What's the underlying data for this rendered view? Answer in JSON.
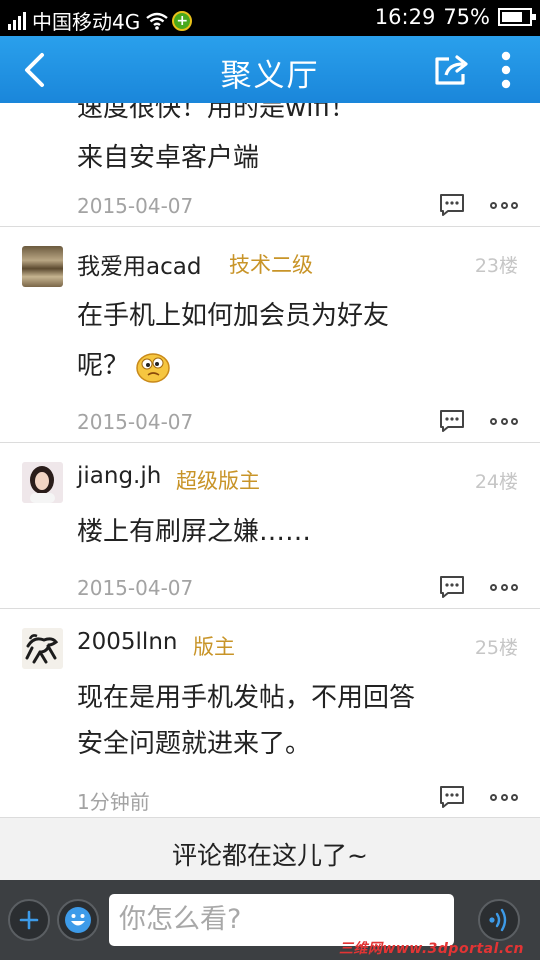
{
  "status_bar": {
    "carrier": "中国移动4G",
    "time": "16:29",
    "battery_percent": "75%",
    "battery_level": 0.75
  },
  "header": {
    "title": "聚义厅",
    "back_icon": "chevron-left-icon",
    "share_icon": "share-icon",
    "more_icon": "more-vertical-icon"
  },
  "posts": [
    {
      "body_lines": [
        "速度很快！用的是wifi！",
        "来自安卓客户端"
      ],
      "date": "2015-04-07"
    },
    {
      "username": "我爱用acad",
      "rank": "技术二级",
      "floor": "23楼",
      "body_lines": [
        "在手机上如何加会员为好友",
        "呢？"
      ],
      "date": "2015-04-07"
    },
    {
      "username": "jiang.jh",
      "rank": "超级版主",
      "floor": "24楼",
      "body_lines": [
        "楼上有刷屏之嫌……"
      ],
      "date": "2015-04-07"
    },
    {
      "username": "2005llnn",
      "rank": "版主",
      "floor": "25楼",
      "body_lines": [
        "现在是用手机发帖，不用回答",
        "安全问题就进来了。"
      ],
      "date": "1分钟前"
    }
  ],
  "footer_hint": "评论都在这儿了~",
  "input_bar": {
    "placeholder": "你怎么看?",
    "add_icon": "plus-icon",
    "emoji_icon": "smiley-icon",
    "voice_icon": "voice-icon"
  },
  "watermark": "三维网www.3dportal.cn",
  "colors": {
    "header": "#1e90e0",
    "rank": "#c89428",
    "floor": "#c6c6c6",
    "date": "#a3a3a3"
  }
}
